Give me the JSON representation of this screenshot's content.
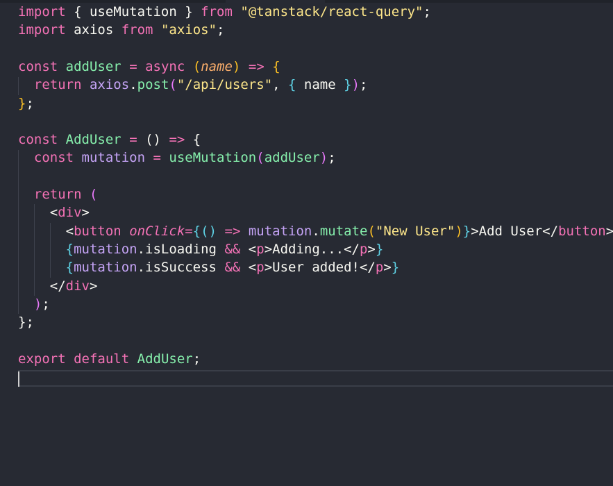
{
  "editor": {
    "language": "javascript",
    "lines": [
      {
        "tokens": [
          {
            "t": "import",
            "c": "kw"
          },
          {
            "t": " ",
            "c": "p"
          },
          {
            "t": "{",
            "c": "p"
          },
          {
            "t": " useMutation ",
            "c": "p"
          },
          {
            "t": "}",
            "c": "p"
          },
          {
            "t": " ",
            "c": "p"
          },
          {
            "t": "from",
            "c": "kw"
          },
          {
            "t": " ",
            "c": "p"
          },
          {
            "t": "\"@tanstack/react-query\"",
            "c": "str"
          },
          {
            "t": ";",
            "c": "p"
          }
        ]
      },
      {
        "tokens": [
          {
            "t": "import",
            "c": "kw"
          },
          {
            "t": " axios ",
            "c": "p"
          },
          {
            "t": "from",
            "c": "kw"
          },
          {
            "t": " ",
            "c": "p"
          },
          {
            "t": "\"axios\"",
            "c": "str"
          },
          {
            "t": ";",
            "c": "p"
          }
        ]
      },
      {
        "tokens": []
      },
      {
        "tokens": [
          {
            "t": "const",
            "c": "kw"
          },
          {
            "t": " ",
            "c": "p"
          },
          {
            "t": "addUser",
            "c": "fn"
          },
          {
            "t": " ",
            "c": "p"
          },
          {
            "t": "=",
            "c": "op"
          },
          {
            "t": " ",
            "c": "p"
          },
          {
            "t": "async",
            "c": "kw"
          },
          {
            "t": " ",
            "c": "p"
          },
          {
            "t": "(",
            "c": "b1"
          },
          {
            "t": "name",
            "c": "param"
          },
          {
            "t": ")",
            "c": "b1"
          },
          {
            "t": " ",
            "c": "p"
          },
          {
            "t": "=>",
            "c": "op"
          },
          {
            "t": " ",
            "c": "p"
          },
          {
            "t": "{",
            "c": "b1"
          }
        ]
      },
      {
        "tokens": [
          {
            "t": "  ",
            "c": "p"
          },
          {
            "t": "return",
            "c": "kw"
          },
          {
            "t": " ",
            "c": "p"
          },
          {
            "t": "axios",
            "c": "var"
          },
          {
            "t": ".",
            "c": "p"
          },
          {
            "t": "post",
            "c": "fn"
          },
          {
            "t": "(",
            "c": "b2"
          },
          {
            "t": "\"/api/users\"",
            "c": "str"
          },
          {
            "t": ", ",
            "c": "p"
          },
          {
            "t": "{",
            "c": "b3"
          },
          {
            "t": " name ",
            "c": "p"
          },
          {
            "t": "}",
            "c": "b3"
          },
          {
            "t": ")",
            "c": "b2"
          },
          {
            "t": ";",
            "c": "p"
          }
        ]
      },
      {
        "tokens": [
          {
            "t": "}",
            "c": "b1"
          },
          {
            "t": ";",
            "c": "p"
          }
        ]
      },
      {
        "tokens": []
      },
      {
        "tokens": [
          {
            "t": "const",
            "c": "kw"
          },
          {
            "t": " ",
            "c": "p"
          },
          {
            "t": "AddUser",
            "c": "fn"
          },
          {
            "t": " ",
            "c": "p"
          },
          {
            "t": "=",
            "c": "op"
          },
          {
            "t": " ",
            "c": "p"
          },
          {
            "t": "()",
            "c": "p"
          },
          {
            "t": " ",
            "c": "p"
          },
          {
            "t": "=>",
            "c": "op"
          },
          {
            "t": " ",
            "c": "p"
          },
          {
            "t": "{",
            "c": "p"
          }
        ]
      },
      {
        "tokens": [
          {
            "t": "  ",
            "c": "p"
          },
          {
            "t": "const",
            "c": "kw"
          },
          {
            "t": " ",
            "c": "p"
          },
          {
            "t": "mutation",
            "c": "var"
          },
          {
            "t": " ",
            "c": "p"
          },
          {
            "t": "=",
            "c": "op"
          },
          {
            "t": " ",
            "c": "p"
          },
          {
            "t": "useMutation",
            "c": "fn"
          },
          {
            "t": "(",
            "c": "b2"
          },
          {
            "t": "addUser",
            "c": "fn"
          },
          {
            "t": ")",
            "c": "b2"
          },
          {
            "t": ";",
            "c": "p"
          }
        ]
      },
      {
        "tokens": []
      },
      {
        "tokens": [
          {
            "t": "  ",
            "c": "p"
          },
          {
            "t": "return",
            "c": "kw"
          },
          {
            "t": " ",
            "c": "p"
          },
          {
            "t": "(",
            "c": "b2"
          }
        ]
      },
      {
        "tokens": [
          {
            "t": "    ",
            "c": "p"
          },
          {
            "t": "<",
            "c": "p"
          },
          {
            "t": "div",
            "c": "tag"
          },
          {
            "t": ">",
            "c": "p"
          }
        ]
      },
      {
        "tokens": [
          {
            "t": "      ",
            "c": "p"
          },
          {
            "t": "<",
            "c": "p"
          },
          {
            "t": "button",
            "c": "tag"
          },
          {
            "t": " ",
            "c": "p"
          },
          {
            "t": "onClick",
            "c": "attr"
          },
          {
            "t": "=",
            "c": "op"
          },
          {
            "t": "{",
            "c": "b3"
          },
          {
            "t": "()",
            "c": "b3"
          },
          {
            "t": " ",
            "c": "p"
          },
          {
            "t": "=>",
            "c": "op"
          },
          {
            "t": " ",
            "c": "p"
          },
          {
            "t": "mutation",
            "c": "var"
          },
          {
            "t": ".",
            "c": "p"
          },
          {
            "t": "mutate",
            "c": "fn"
          },
          {
            "t": "(",
            "c": "b1"
          },
          {
            "t": "\"New User\"",
            "c": "str"
          },
          {
            "t": ")",
            "c": "b1"
          },
          {
            "t": "}",
            "c": "b3"
          },
          {
            "t": ">Add User</",
            "c": "p"
          },
          {
            "t": "button",
            "c": "tag"
          },
          {
            "t": ">",
            "c": "p"
          }
        ]
      },
      {
        "tokens": [
          {
            "t": "      ",
            "c": "p"
          },
          {
            "t": "{",
            "c": "b3"
          },
          {
            "t": "mutation",
            "c": "var"
          },
          {
            "t": ".isLoading ",
            "c": "p"
          },
          {
            "t": "&&",
            "c": "op"
          },
          {
            "t": " <",
            "c": "p"
          },
          {
            "t": "p",
            "c": "tag"
          },
          {
            "t": ">Adding...</",
            "c": "p"
          },
          {
            "t": "p",
            "c": "tag"
          },
          {
            "t": ">",
            "c": "p"
          },
          {
            "t": "}",
            "c": "b3"
          }
        ]
      },
      {
        "tokens": [
          {
            "t": "      ",
            "c": "p"
          },
          {
            "t": "{",
            "c": "b3"
          },
          {
            "t": "mutation",
            "c": "var"
          },
          {
            "t": ".isSuccess ",
            "c": "p"
          },
          {
            "t": "&&",
            "c": "op"
          },
          {
            "t": " <",
            "c": "p"
          },
          {
            "t": "p",
            "c": "tag"
          },
          {
            "t": ">User added!</",
            "c": "p"
          },
          {
            "t": "p",
            "c": "tag"
          },
          {
            "t": ">",
            "c": "p"
          },
          {
            "t": "}",
            "c": "b3"
          }
        ]
      },
      {
        "tokens": [
          {
            "t": "    ",
            "c": "p"
          },
          {
            "t": "</",
            "c": "p"
          },
          {
            "t": "div",
            "c": "tag"
          },
          {
            "t": ">",
            "c": "p"
          }
        ]
      },
      {
        "tokens": [
          {
            "t": "  ",
            "c": "p"
          },
          {
            "t": ")",
            "c": "b2"
          },
          {
            "t": ";",
            "c": "p"
          }
        ]
      },
      {
        "tokens": [
          {
            "t": "}",
            "c": "p"
          },
          {
            "t": ";",
            "c": "p"
          }
        ]
      },
      {
        "tokens": []
      },
      {
        "tokens": [
          {
            "t": "export",
            "c": "kw"
          },
          {
            "t": " ",
            "c": "p"
          },
          {
            "t": "default",
            "c": "kw"
          },
          {
            "t": " ",
            "c": "p"
          },
          {
            "t": "AddUser",
            "c": "fn"
          },
          {
            "t": ";",
            "c": "p"
          }
        ]
      },
      {
        "tokens": []
      }
    ]
  },
  "colors": {
    "background": "#272a33",
    "keyword": "#f472b6",
    "function": "#86efac",
    "string": "#fde68a",
    "variable": "#c4a3f5",
    "parameter": "#fbae6b"
  }
}
